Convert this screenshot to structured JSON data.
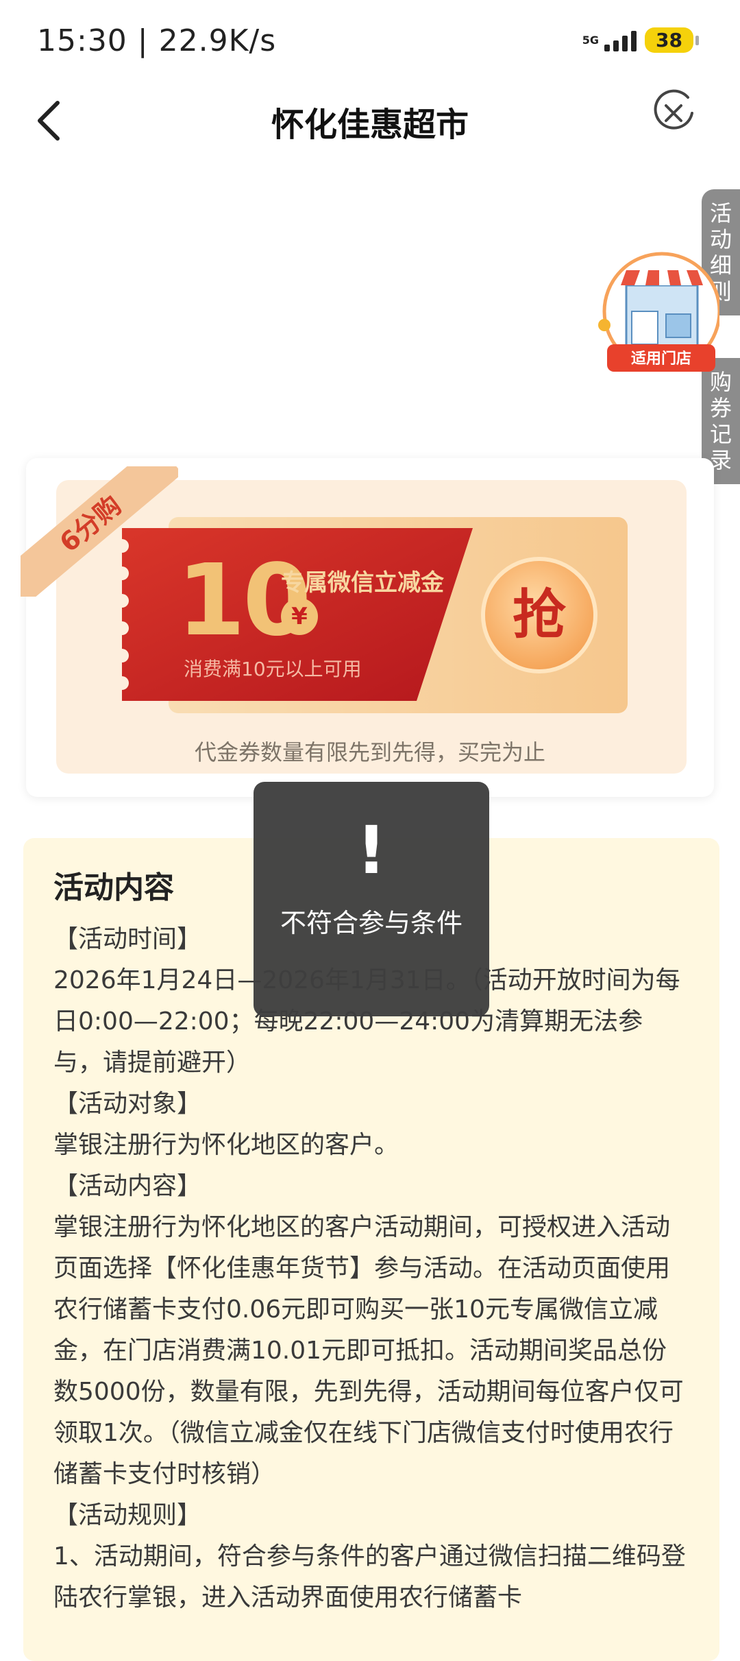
{
  "status_bar": {
    "time": "15:30 | 22.9K/s",
    "network": "5G",
    "battery": "38"
  },
  "nav": {
    "title": "怀化佳惠超市",
    "back_icon": "chevron-left-icon",
    "close_icon": "close-circle-icon"
  },
  "side_tabs": {
    "details": "活动细则",
    "records": "购券记录",
    "store_badge": "适用门店"
  },
  "coupon": {
    "ribbon": "6分购",
    "amount": "10",
    "currency": "¥",
    "name": "专属微信立减金",
    "condition": "消费满10元以上可用",
    "button": "抢",
    "note": "代金券数量有限先到先得，买完为止"
  },
  "activity": {
    "title": "活动内容",
    "paragraphs": [
      "【活动时间】",
      "2026年1月24日—2026年1月31日。（活动开放时间为每日0:00—22:00；每晚22:00—24:00为清算期无法参与，请提前避开）",
      "【活动对象】",
      "掌银注册行为怀化地区的客户。",
      "【活动内容】",
      "掌银注册行为怀化地区的客户活动期间，可授权进入活动页面选择【怀化佳惠年货节】参与活动。在活动页面使用农行储蓄卡支付0.06元即可购买一张10元专属微信立减金，在门店消费满10.01元即可抵扣。活动期间奖品总份数5000份，数量有限，先到先得，活动期间每位客户仅可领取1次。（微信立减金仅在线下门店微信支付时使用农行储蓄卡支付时核销）",
      "【活动规则】",
      "1、活动期间，符合参与条件的客户通过微信扫描二维码登陆农行掌银，进入活动界面使用农行储蓄卡"
    ]
  },
  "toast": {
    "mark": "!",
    "message": "不符合参与条件"
  },
  "colors": {
    "coupon_red": "#c81f1f",
    "coupon_gold": "#f2c276",
    "toast_bg": "#3e3e3e",
    "activity_bg": "#fff8e0",
    "side_tab_bg": "#8c8c8c"
  }
}
